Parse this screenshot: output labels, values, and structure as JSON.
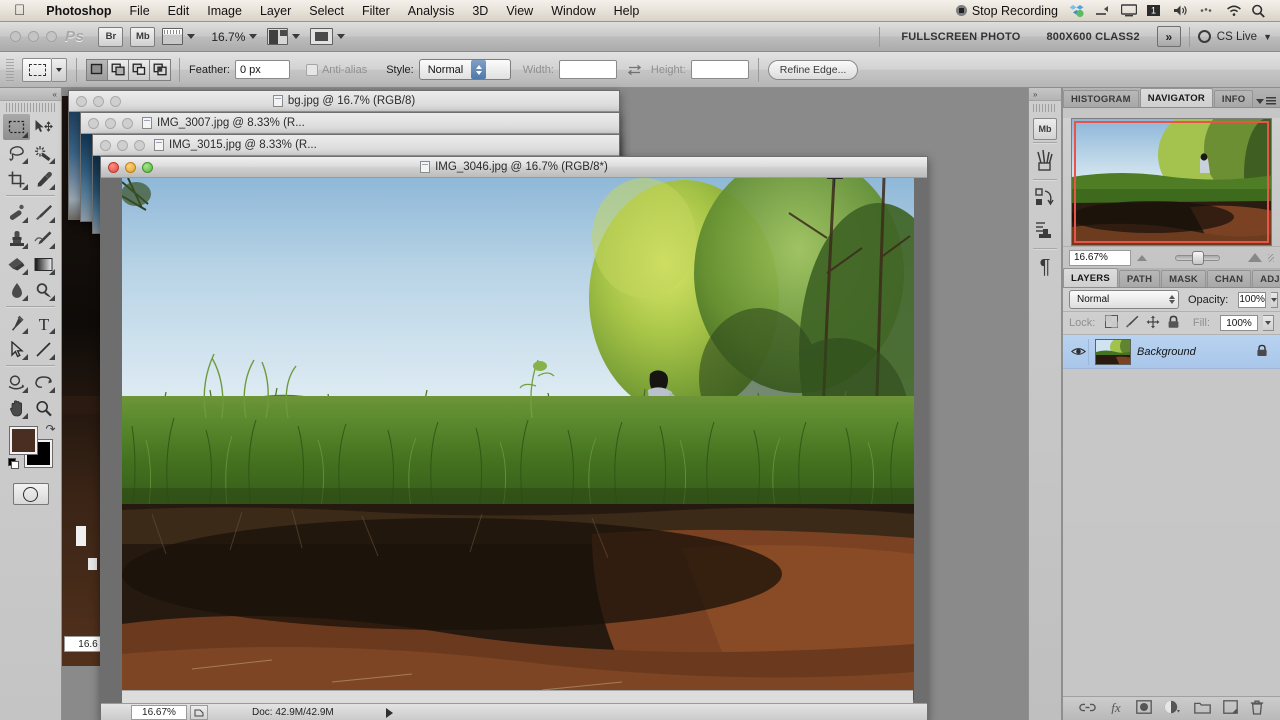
{
  "menubar": {
    "apple_icon": "apple-logo-icon",
    "app_name": "Photoshop",
    "items": [
      "File",
      "Edit",
      "Image",
      "Layer",
      "Select",
      "Filter",
      "Analysis",
      "3D",
      "View",
      "Window",
      "Help"
    ],
    "status": {
      "recording_label": "Stop Recording",
      "icons": [
        "dropbox-icon",
        "airplay-icon",
        "display-icon",
        "battery-icon",
        "volume-icon",
        "bluetooth-icon",
        "wifi-icon",
        "spotlight-search-icon"
      ]
    }
  },
  "appbar": {
    "bridge_label": "Br",
    "minibridge_label": "Mb",
    "view_extras_icon": "view-extras-icon",
    "zoom_level": "16.7%",
    "arrange_icon": "arrange-documents-icon",
    "screen_mode_icon": "screen-mode-icon",
    "workspaces": [
      "FULLSCREEN PHOTO",
      "800X600 CLASS2"
    ],
    "overflow_label": "»",
    "cs_live_label": "CS Live"
  },
  "optionsbar": {
    "tool_preset_icon": "rectangular-marquee-icon",
    "bool_modes": [
      "new-selection",
      "add-to-selection",
      "subtract-from-selection",
      "intersect-selection"
    ],
    "feather_label": "Feather:",
    "feather_value": "0 px",
    "antialias_label": "Anti-alias",
    "antialias_checked": false,
    "style_label": "Style:",
    "style_value": "Normal",
    "width_label": "Width:",
    "width_value": "",
    "height_label": "Height:",
    "height_value": "",
    "swap_icon": "swap-dimensions-icon",
    "refine_edge_label": "Refine Edge..."
  },
  "toolbar": {
    "collapse_icon": "collapse-panel-icon",
    "tools": [
      {
        "name": "rectangular-marquee-tool",
        "selected": true
      },
      {
        "name": "move-tool",
        "selected": false
      },
      {
        "name": "lasso-tool",
        "selected": false
      },
      {
        "name": "quick-selection-tool",
        "selected": false
      },
      {
        "name": "crop-tool",
        "selected": false
      },
      {
        "name": "eyedropper-tool",
        "selected": false
      },
      {
        "name": "spot-healing-brush-tool",
        "selected": false
      },
      {
        "name": "brush-tool",
        "selected": false
      },
      {
        "name": "clone-stamp-tool",
        "selected": false
      },
      {
        "name": "history-brush-tool",
        "selected": false
      },
      {
        "name": "eraser-tool",
        "selected": false
      },
      {
        "name": "gradient-tool",
        "selected": false
      },
      {
        "name": "blur-tool",
        "selected": false
      },
      {
        "name": "dodge-tool",
        "selected": false
      },
      {
        "name": "pen-tool",
        "selected": false
      },
      {
        "name": "type-tool",
        "selected": false
      },
      {
        "name": "path-selection-tool",
        "selected": false
      },
      {
        "name": "line-shape-tool",
        "selected": false
      },
      {
        "name": "3d-rotate-tool",
        "selected": false
      },
      {
        "name": "3d-orbit-camera-tool",
        "selected": false
      },
      {
        "name": "hand-tool",
        "selected": false
      },
      {
        "name": "zoom-tool",
        "selected": false
      }
    ],
    "foreground_color": "#4a2e22",
    "background_color": "#000000",
    "swap_colors_icon": "swap-colors-icon",
    "default_colors_icon": "default-colors-icon",
    "quick_mask_icon": "quick-mask-icon"
  },
  "windows": [
    {
      "title": "bg.jpg @ 16.7% (RGB/8)",
      "active": false
    },
    {
      "title": "IMG_3007.jpg @ 8.33% (R...",
      "active": false
    },
    {
      "title": "IMG_3015.jpg @ 8.33% (R...",
      "active": false
    }
  ],
  "document": {
    "title": "IMG_3046.jpg @ 16.7% (RGB/8*)",
    "active": true,
    "statusbar": {
      "zoom": "16.67%",
      "doc_info": "Doc: 42.9M/42.9M",
      "expand_icon": "expand-status-icon"
    },
    "behind_window_zoom": "16.6"
  },
  "icondock": {
    "collapse_icon": "expand-panels-icon",
    "buttons": [
      {
        "name": "mini-bridge-panel-icon",
        "label": "Mb"
      },
      {
        "name": "brush-panel-icon",
        "label": ""
      },
      {
        "name": "history-panel-icon",
        "label": ""
      },
      {
        "name": "actions-panel-icon",
        "label": ""
      },
      {
        "name": "paragraph-panel-icon",
        "label": "¶"
      }
    ]
  },
  "navigator_panel": {
    "tabs": [
      {
        "label": "HISTOGRAM",
        "active": false
      },
      {
        "label": "NAVIGATOR",
        "active": true
      },
      {
        "label": "INFO",
        "active": false
      }
    ],
    "menu_icon": "panel-menu-icon",
    "zoom_value": "16.67%",
    "view_box_color": "#e8534a",
    "zoom_out_icon": "zoom-out-icon",
    "zoom_in_icon": "zoom-in-icon",
    "slider_icon": "zoom-slider"
  },
  "layers_panel": {
    "tabs": [
      {
        "label": "LAYERS",
        "active": true
      },
      {
        "label": "PATH",
        "active": false
      },
      {
        "label": "MASK",
        "active": false
      },
      {
        "label": "CHAN",
        "active": false
      },
      {
        "label": "ADJU",
        "active": false
      }
    ],
    "menu_icon": "panel-menu-icon",
    "blend_mode": "Normal",
    "opacity_label": "Opacity:",
    "opacity_value": "100%",
    "lock_label": "Lock:",
    "lock_icons": [
      "lock-transparent-pixels-icon",
      "lock-image-pixels-icon",
      "lock-position-icon",
      "lock-all-icon"
    ],
    "fill_label": "Fill:",
    "fill_value": "100%",
    "layers": [
      {
        "name": "Background",
        "visible": true,
        "locked": true,
        "selected": true,
        "visibility_icon": "eye-icon",
        "lock_icon": "lock-icon"
      }
    ],
    "footer_icons": [
      "link-layers-icon",
      "layer-style-icon",
      "layer-mask-icon",
      "adjustment-layer-icon",
      "new-group-icon",
      "new-layer-icon",
      "delete-layer-icon"
    ]
  }
}
